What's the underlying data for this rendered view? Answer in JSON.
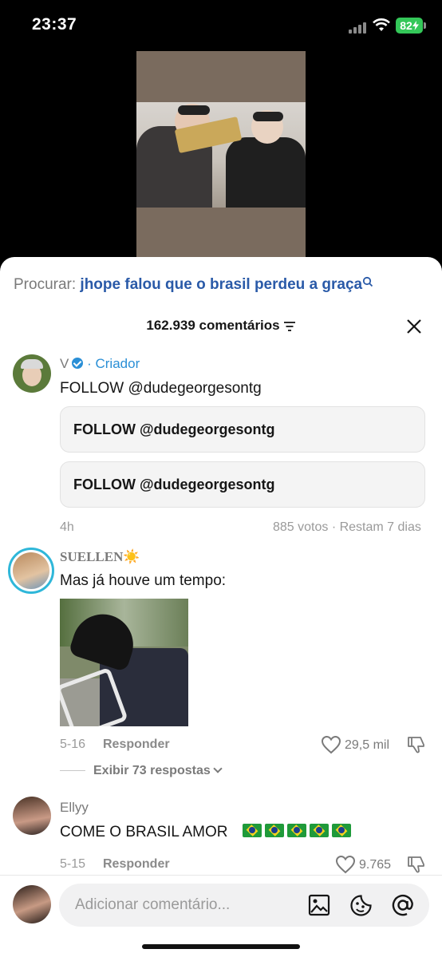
{
  "status": {
    "time": "23:37",
    "battery": "82"
  },
  "search": {
    "label": "Procurar:",
    "query": "jhope falou que o brasil perdeu a graça"
  },
  "comments_header": {
    "count": "162.939 comentários"
  },
  "creator_comment": {
    "username": "V",
    "separator": "·",
    "tag": "Criador",
    "text": "FOLLOW @dudegeorgesontg",
    "poll_options": [
      "FOLLOW @dudegeorgesontg",
      "FOLLOW @dudegeorgesontg"
    ],
    "time": "4h",
    "poll_meta": "885 votos · Restam 7 dias"
  },
  "comments": [
    {
      "username": "SUELLEN☀️",
      "text": "Mas já houve um tempo:",
      "date": "5-16",
      "reply_label": "Responder",
      "likes": "29,5 mil",
      "view_replies": "Exibir 73 respostas"
    },
    {
      "username": "Ellyy",
      "text": "COME O BRASIL AMOR",
      "flags": "🇧🇷🇧🇷🇧🇷🇧🇷🇧🇷",
      "date": "5-15",
      "reply_label": "Responder",
      "likes": "9.765"
    }
  ],
  "composer": {
    "placeholder": "Adicionar comentário..."
  },
  "icons": [
    "search-icon",
    "sort-icon",
    "close-icon",
    "verified-icon",
    "heart-icon",
    "dislike-icon",
    "image-icon",
    "emoji-icon",
    "mention-icon"
  ],
  "colors": {
    "link": "#2a5aa8",
    "creator": "#2a8fd6",
    "story_ring": "#2fb7d9",
    "battery": "#34c759"
  }
}
